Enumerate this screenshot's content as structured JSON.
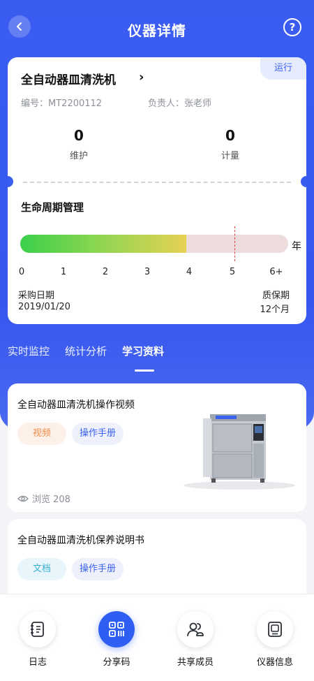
{
  "header": {
    "title": "仪器详情",
    "help_symbol": "?"
  },
  "device": {
    "name": "全自动器皿清洗机",
    "status": "运行",
    "id_label": "编号：",
    "id_value": "MT2200112",
    "owner_label": "负责人：",
    "owner_value": "张老师",
    "maintenance_count": "0",
    "maintenance_label": "维护",
    "metering_count": "0",
    "metering_label": "计量"
  },
  "lifecycle": {
    "title": "生命周期管理",
    "unit": "年",
    "ticks": [
      "0",
      "1",
      "2",
      "3",
      "4",
      "5",
      "6+"
    ],
    "elapsed_years": 3.9,
    "warranty_marker_years": 5,
    "max_years": 6.5,
    "purchase_label": "采购日期",
    "purchase_date": "2019/01/20",
    "warranty_label": "质保期",
    "warranty_value": "12个月"
  },
  "tabs": [
    "实时监控",
    "统计分析",
    "学习资料"
  ],
  "active_tab": 2,
  "resources": [
    {
      "title": "全自动器皿清洗机操作视频",
      "tags": [
        "视频",
        "操作手册"
      ],
      "views": "浏览 208"
    },
    {
      "title": "全自动器皿清洗机保养说明书",
      "tags": [
        "文档",
        "操作手册"
      ]
    }
  ],
  "bottom_nav": [
    {
      "label": "日志",
      "icon": "log-icon"
    },
    {
      "label": "分享码",
      "icon": "qr-code-icon"
    },
    {
      "label": "共享成员",
      "icon": "members-icon"
    },
    {
      "label": "仪器信息",
      "icon": "device-info-icon"
    }
  ],
  "colors": {
    "primary": "#3a5df0",
    "video_tag": "#f08a4b",
    "doc_tag": "#3bb0d6",
    "manual_tag": "#3b62f0"
  }
}
